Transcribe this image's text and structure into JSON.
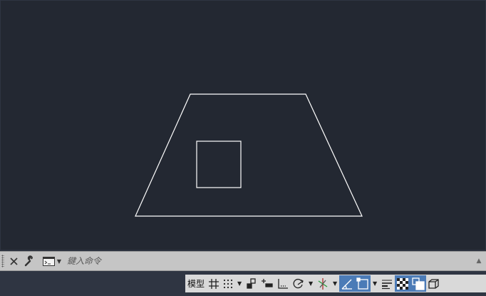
{
  "viewport": {
    "background": "#232832",
    "line_color": "#ffffff"
  },
  "command_line": {
    "placeholder": "鍵入命令",
    "icons": [
      "grip-handle",
      "close-icon",
      "wrench-icon",
      "command-prompt-icon",
      "dropdown-arrow-icon",
      "scroll-up-arrow-icon"
    ]
  },
  "status_bar": {
    "model_label": "模型",
    "tools": [
      {
        "name": "grid-icon",
        "active": false
      },
      {
        "name": "snap-mode-icon",
        "active": false
      },
      {
        "name": "infer-constraints-icon",
        "active": false
      },
      {
        "name": "dynamic-input-icon",
        "active": false
      },
      {
        "name": "ortho-mode-icon",
        "active": false
      },
      {
        "name": "polar-tracking-icon",
        "active": false
      },
      {
        "name": "isometric-drafting-icon",
        "active": false
      },
      {
        "name": "object-snap-tracking-icon",
        "active": true
      },
      {
        "name": "object-snap-icon",
        "active": true
      },
      {
        "name": "lineweight-icon",
        "active": false
      },
      {
        "name": "transparency-icon",
        "active": true
      },
      {
        "name": "selection-cycling-icon",
        "active": true
      },
      {
        "name": "3d-object-snap-icon",
        "active": false
      }
    ]
  }
}
